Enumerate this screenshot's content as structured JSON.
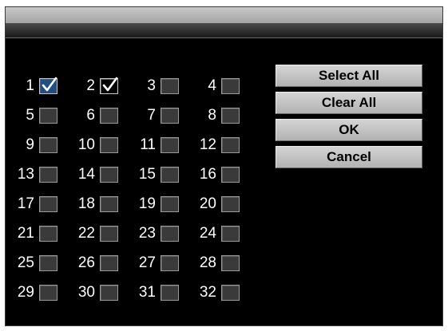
{
  "dialog": {
    "title": ""
  },
  "channels": [
    {
      "label": "1",
      "checked": true
    },
    {
      "label": "2",
      "checked": true
    },
    {
      "label": "3",
      "checked": false
    },
    {
      "label": "4",
      "checked": false
    },
    {
      "label": "5",
      "checked": false
    },
    {
      "label": "6",
      "checked": false
    },
    {
      "label": "7",
      "checked": false
    },
    {
      "label": "8",
      "checked": false
    },
    {
      "label": "9",
      "checked": false
    },
    {
      "label": "10",
      "checked": false
    },
    {
      "label": "11",
      "checked": false
    },
    {
      "label": "12",
      "checked": false
    },
    {
      "label": "13",
      "checked": false
    },
    {
      "label": "14",
      "checked": false
    },
    {
      "label": "15",
      "checked": false
    },
    {
      "label": "16",
      "checked": false
    },
    {
      "label": "17",
      "checked": false
    },
    {
      "label": "18",
      "checked": false
    },
    {
      "label": "19",
      "checked": false
    },
    {
      "label": "20",
      "checked": false
    },
    {
      "label": "21",
      "checked": false
    },
    {
      "label": "22",
      "checked": false
    },
    {
      "label": "23",
      "checked": false
    },
    {
      "label": "24",
      "checked": false
    },
    {
      "label": "25",
      "checked": false
    },
    {
      "label": "26",
      "checked": false
    },
    {
      "label": "27",
      "checked": false
    },
    {
      "label": "28",
      "checked": false
    },
    {
      "label": "29",
      "checked": false
    },
    {
      "label": "30",
      "checked": false
    },
    {
      "label": "31",
      "checked": false
    },
    {
      "label": "32",
      "checked": false
    }
  ],
  "buttons": {
    "select_all": "Select All",
    "clear_all": "Clear All",
    "ok": "OK",
    "cancel": "Cancel"
  },
  "icons": {
    "checked": "checkmark-icon"
  },
  "colors": {
    "background": "#000000",
    "focused_checkbox": "#1f4f86",
    "button_face": "#c4c4c4"
  }
}
